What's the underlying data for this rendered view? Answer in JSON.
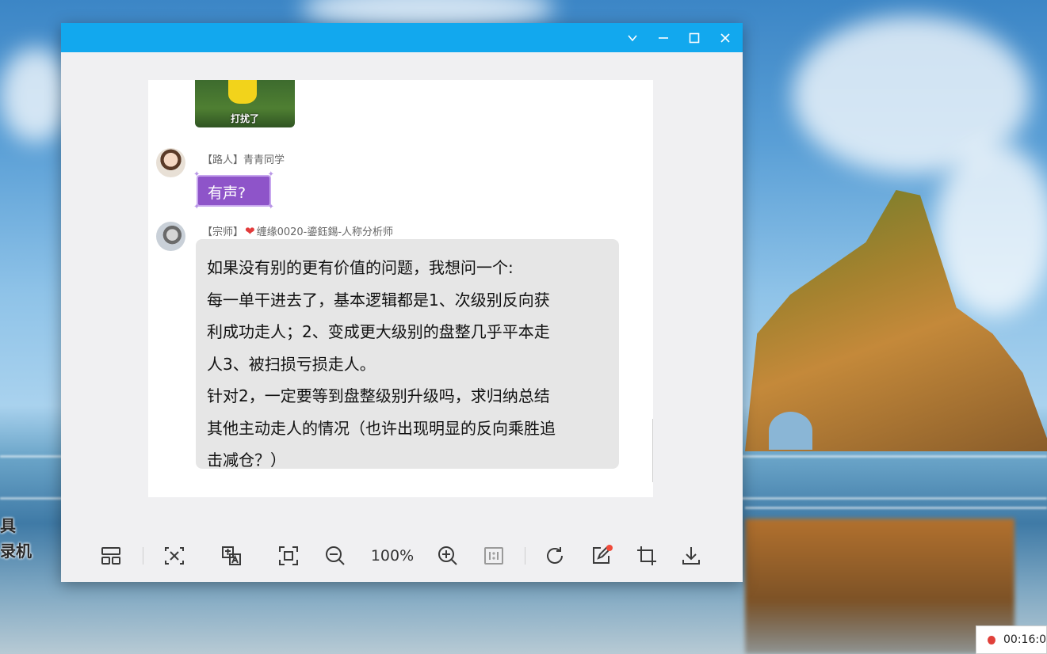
{
  "window": {
    "controls": [
      "chevron-down",
      "minimize",
      "maximize",
      "close"
    ],
    "titlebar_color": "#12a8ee"
  },
  "chat": {
    "sticker_caption": "打扰了",
    "messages": [
      {
        "sender": "【路人】青青同学",
        "text": "有声?"
      },
      {
        "sender_prefix": "【宗师】",
        "sender_name": "缠缘0020-鎏鈺錫-人称分析师",
        "lines": [
          "如果没有别的更有价值的问题，我想问一个:",
          "每一单干进去了，基本逻辑都是1、次级别反向获",
          "利成功走人；2、变成更大级别的盘整几乎平本走",
          "人3、被扫损亏损走人。",
          "针对2，一定要等到盘整级别升级吗，求归纳总结",
          "其他主动走人的情况（也许出现明显的反向乘胜追",
          "击减仓？）"
        ]
      }
    ]
  },
  "toolbar": {
    "zoom_level": "100%",
    "tools": [
      "layout-icon",
      "ocr-icon",
      "translate-icon",
      "fit-window-icon",
      "zoom-out-icon",
      "zoom-in-icon",
      "actual-size-icon",
      "rotate-icon",
      "edit-icon",
      "crop-icon",
      "download-icon"
    ]
  },
  "desktop": {
    "overlay_text_1": "具",
    "overlay_text_2": "录机"
  },
  "recording": {
    "timer": "00:16:0"
  }
}
